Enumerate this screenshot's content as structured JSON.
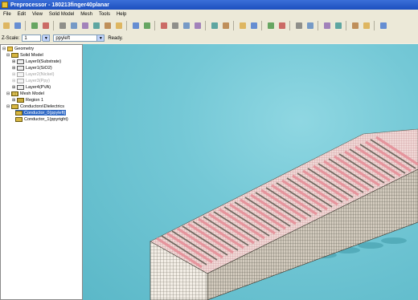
{
  "window": {
    "title": "Preprocessor - 180213finger40planar"
  },
  "menu": [
    "File",
    "Edit",
    "View",
    "Solid Model",
    "Mesh",
    "Tools",
    "Help"
  ],
  "toolbar": {
    "icons": [
      "open-icon",
      "save-icon",
      "undo-icon",
      "export-icon",
      "view-top-icon",
      "view-front-icon",
      "view-side-icon",
      "view-iso-icon",
      "view-back-icon",
      "view-bottom-icon",
      "pan-icon",
      "move-icon",
      "zoom-icon",
      "zoom-in-icon",
      "zoom-out-icon",
      "zoom-fit-icon",
      "axis-icon",
      "rotate-left-icon",
      "rotate-right-icon",
      "mesh-icon",
      "select-icon",
      "shape-icon",
      "copy-icon",
      "paste-icon",
      "chart-icon",
      "delete-icon",
      "measure-icon",
      "dimension-icon",
      "pointer-icon"
    ]
  },
  "scale": {
    "label": "Z-Scale:",
    "value": "1",
    "layer": "ppyleft",
    "status": "Ready."
  },
  "tree": {
    "root": "Geometry",
    "solid_model": "Solid Model",
    "layers": [
      {
        "label": "Layer0(Substrate)",
        "color": "#000000"
      },
      {
        "label": "Layer1(SiO2)",
        "color": "#000000"
      },
      {
        "label": "Layer2(Nickel)",
        "color": "#a0a0a0"
      },
      {
        "label": "Layer3(Ppy)",
        "color": "#a0a0a0"
      },
      {
        "label": "Layer4(PVA)",
        "color": "#000000"
      }
    ],
    "mesh_model": "Mesh Model",
    "region": "Region 1",
    "conductors_label": "Conductors\\Dielectrics",
    "conductors": [
      {
        "label": "Conductor_0(ppyleft)",
        "selected": true
      },
      {
        "label": "Conductor_1(ppyright)",
        "selected": false
      }
    ]
  },
  "colors": {
    "viewport": "#74c8d6",
    "selection": "#316ac5",
    "mesh_light": "#f3e9e2",
    "mesh_fingers": "#e9a7ae",
    "mesh_dark": "#59584e"
  }
}
